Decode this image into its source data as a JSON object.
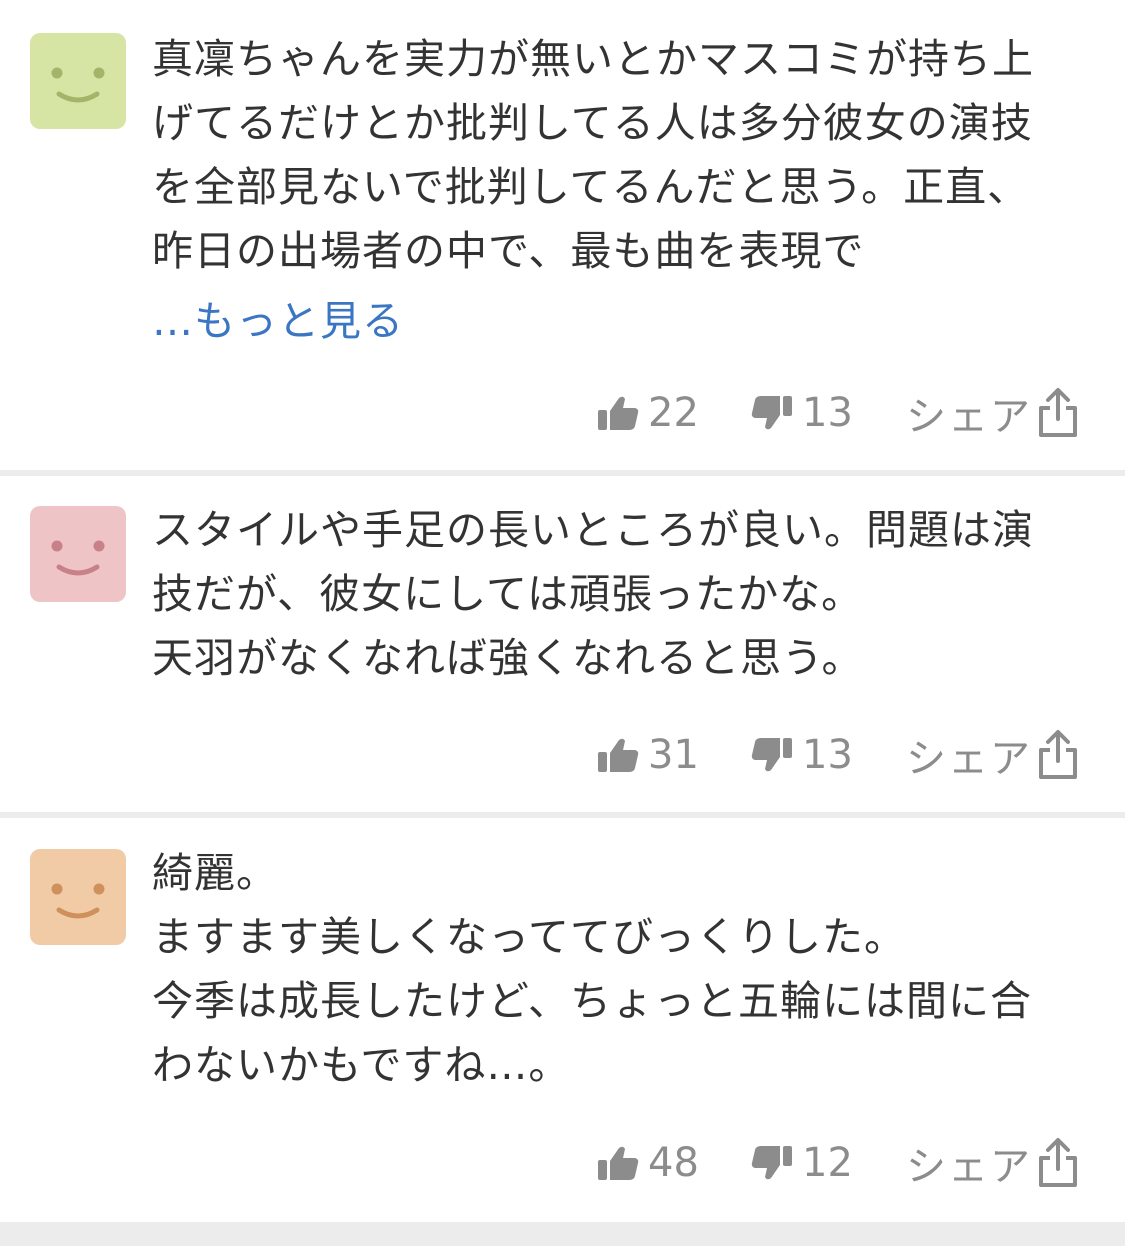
{
  "comments": [
    {
      "avatar_color": "#d7e5a4",
      "face_color": "#a4b56a",
      "text": "真凜ちゃんを実力が無いとかマスコミが持ち上\nげてるだけとか批判してる人は多分彼女の演技\nを全部見ないで批判してるんだと思う。正直、\n昨日の出場者の中で、最も曲を表現で",
      "more_label": "…もっと見る",
      "likes": "22",
      "dislikes": "13",
      "share_label": "シェア",
      "like_icon": "thumbs-up-icon",
      "dislike_icon": "thumbs-down-icon",
      "share_icon": "share-icon"
    },
    {
      "avatar_color": "#eec4c7",
      "face_color": "#c98189",
      "text": "スタイルや手足の長いところが良い。問題は演\n技だが、彼女にしては頑張ったかな。\n天羽がなくなれば強くなれると思う。",
      "likes": "31",
      "dislikes": "13",
      "share_label": "シェア",
      "like_icon": "thumbs-up-icon",
      "dislike_icon": "thumbs-down-icon",
      "share_icon": "share-icon"
    },
    {
      "avatar_color": "#f1cba6",
      "face_color": "#cf915b",
      "text": "綺麗。\nますます美しくなっててびっくりした。\n今季は成長したけど、ちょっと五輪には間に合\nわないかもですね…。",
      "likes": "48",
      "dislikes": "12",
      "share_label": "シェア",
      "like_icon": "thumbs-up-icon",
      "dislike_icon": "thumbs-down-icon",
      "share_icon": "share-icon"
    }
  ],
  "colors": {
    "text": "#333333",
    "link": "#3b76c3",
    "muted": "#8c8c8c",
    "divider": "#ececec"
  }
}
